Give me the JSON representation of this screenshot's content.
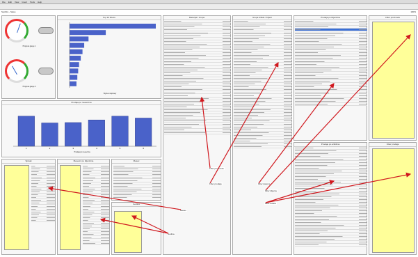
{
  "window": {
    "title": "Spotfire - Sales"
  },
  "menu": [
    "File",
    "Edit",
    "View",
    "Insert",
    "Tools",
    "Help"
  ],
  "toolbar": {
    "zoom_label": "100%"
  },
  "gauges": [
    {
      "caption": "Progress gauge 1"
    },
    {
      "caption": "Progress gauge 2"
    }
  ],
  "charts": {
    "hbar_title": "Top 10 Zboze",
    "hbar_caption": "Wykres slupkowy",
    "vbar_title": "Prodaja po mesecima",
    "vbar_caption": "Prodaja po mesecima"
  },
  "chart_data": [
    {
      "type": "bar",
      "title": "Top 10 Zboze",
      "orientation": "horizontal",
      "values": [
        100,
        42,
        22,
        17,
        15,
        13,
        11,
        10,
        9,
        8
      ]
    },
    {
      "type": "bar",
      "title": "Prodaja po mesecima",
      "orientation": "vertical",
      "categories": [
        "1",
        "2",
        "3",
        "4",
        "5",
        "6"
      ],
      "values": [
        80,
        62,
        63,
        70,
        80,
        75
      ],
      "ylim": [
        0,
        100
      ]
    }
  ],
  "tables": {
    "t1": {
      "title": "Materijal / Grupa",
      "count": 40
    },
    "t2": {
      "title": "Grupa Artikla / Klijent",
      "count": 45
    },
    "t3": {
      "title": "Prodaja po klijentima",
      "count": 30
    },
    "t4": {
      "title": "Prodaja po artiklima",
      "count": 35
    },
    "t5": {
      "title": "Prodaja po mesecima / klijentima",
      "count": 26
    },
    "t6": {
      "title": "Mesecni po klijentima",
      "count": 28
    },
    "t7": {
      "title": "Spisak",
      "count": 20
    }
  },
  "labels": [
    "Filter proizvoda",
    "Filter prodaja",
    "Filter datuma",
    "Filter klijenta",
    "Filter artikla",
    "Mesec",
    "Godina"
  ],
  "colors": {
    "bar": "#4a62c9",
    "yellow": "#ffff99",
    "arrow": "#d0181e"
  }
}
